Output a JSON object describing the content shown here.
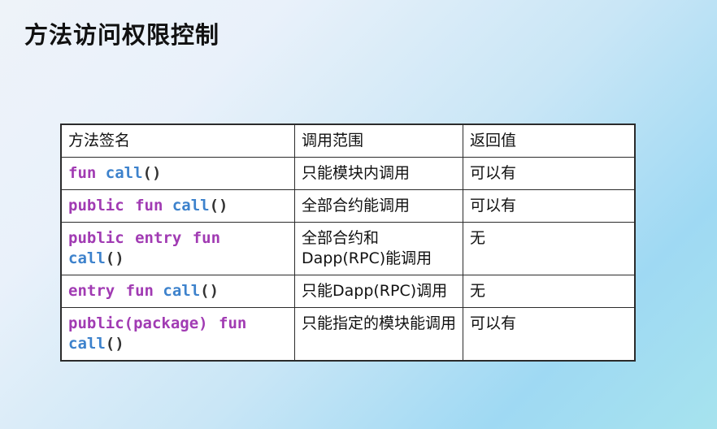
{
  "title": "方法访问权限控制",
  "table": {
    "headers": [
      "方法签名",
      "调用范围",
      "返回值"
    ],
    "rows": [
      {
        "sig": [
          [
            "fun",
            "call",
            "()"
          ]
        ],
        "scope": "只能模块内调用",
        "ret": "可以有"
      },
      {
        "sig": [
          [
            "public fun",
            "call",
            "()"
          ]
        ],
        "scope": "全部合约能调用",
        "ret": "可以有"
      },
      {
        "sig": [
          [
            "public entry fun",
            "",
            ""
          ],
          [
            "",
            "call",
            "()"
          ]
        ],
        "scope": "全部合约和Dapp(RPC)能调用",
        "ret": "无"
      },
      {
        "sig": [
          [
            "entry fun",
            "call",
            "()"
          ]
        ],
        "scope": "只能Dapp(RPC)调用",
        "ret": "无"
      },
      {
        "sig": [
          [
            "public(package) fun",
            "",
            ""
          ],
          [
            "",
            "call",
            "()"
          ]
        ],
        "scope": "只能指定的模块能调用",
        "ret": "可以有"
      }
    ]
  },
  "colors": {
    "keyword": "#a13bb3",
    "function": "#3d82cc",
    "header_accent": "#b03ab8"
  }
}
